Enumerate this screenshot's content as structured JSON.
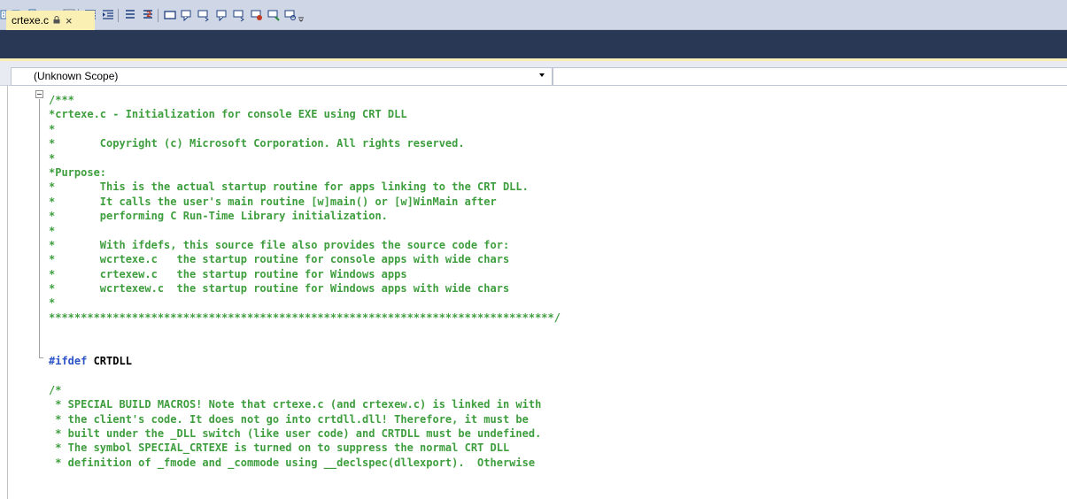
{
  "colors": {
    "toolbar_bg": "#cfd6e5",
    "tab_bar_bg": "#293955",
    "active_tab_bg": "#fbf0b3",
    "comment_green": "#3e9e3e",
    "preprocessor_blue": "#2c55c6"
  },
  "toolbar": {
    "icons": [
      "find-icon",
      "find-in-files-icon",
      "replace-icon",
      "font-size-icon",
      "format-icon",
      "decrease-indent-icon",
      "increase-indent-icon",
      "comment-lines-icon",
      "uncomment-lines-icon",
      "toggle-bookmark-icon",
      "prev-bookmark-icon",
      "next-bookmark-icon",
      "prev-bookmark-folder-icon",
      "next-bookmark-folder-icon",
      "clear-bookmarks-icon",
      "bookmark-window-icon",
      "find-bookmark-icon",
      "toolbar-overflow-icon"
    ]
  },
  "tab": {
    "title": "crtexe.c",
    "lock_icon": "lock-icon",
    "close_glyph": "×"
  },
  "scope": {
    "selected": "(Unknown Scope)"
  },
  "code_lines": [
    {
      "k": "c",
      "t": "/***"
    },
    {
      "k": "c",
      "t": "*crtexe.c - Initialization for console EXE using CRT DLL"
    },
    {
      "k": "c",
      "t": "*"
    },
    {
      "k": "c",
      "t": "*       Copyright (c) Microsoft Corporation. All rights reserved."
    },
    {
      "k": "c",
      "t": "*"
    },
    {
      "k": "c",
      "t": "*Purpose:"
    },
    {
      "k": "c",
      "t": "*       This is the actual startup routine for apps linking to the CRT DLL."
    },
    {
      "k": "c",
      "t": "*       It calls the user's main routine [w]main() or [w]WinMain after"
    },
    {
      "k": "c",
      "t": "*       performing C Run-Time Library initialization."
    },
    {
      "k": "c",
      "t": "*"
    },
    {
      "k": "c",
      "t": "*       With ifdefs, this source file also provides the source code for:"
    },
    {
      "k": "c",
      "t": "*       wcrtexe.c   the startup routine for console apps with wide chars"
    },
    {
      "k": "c",
      "t": "*       crtexew.c   the startup routine for Windows apps"
    },
    {
      "k": "c",
      "t": "*       wcrtexew.c  the startup routine for Windows apps with wide chars"
    },
    {
      "k": "c",
      "t": "*"
    },
    {
      "k": "c",
      "t": "*******************************************************************************/"
    },
    {
      "k": "c",
      "t": ""
    },
    {
      "k": "c",
      "t": ""
    },
    {
      "k": "pp",
      "kw": "#ifdef",
      "rest": " CRTDLL"
    },
    {
      "k": "c",
      "t": ""
    },
    {
      "k": "c",
      "t": "/*"
    },
    {
      "k": "c",
      "t": " * SPECIAL BUILD MACROS! Note that crtexe.c (and crtexew.c) is linked in with"
    },
    {
      "k": "c",
      "t": " * the client's code. It does not go into crtdll.dll! Therefore, it must be"
    },
    {
      "k": "c",
      "t": " * built under the _DLL switch (like user code) and CRTDLL must be undefined."
    },
    {
      "k": "c",
      "t": " * The symbol SPECIAL_CRTEXE is turned on to suppress the normal CRT DLL"
    },
    {
      "k": "c",
      "t": " * definition of _fmode and _commode using __declspec(dllexport).  Otherwise"
    }
  ]
}
